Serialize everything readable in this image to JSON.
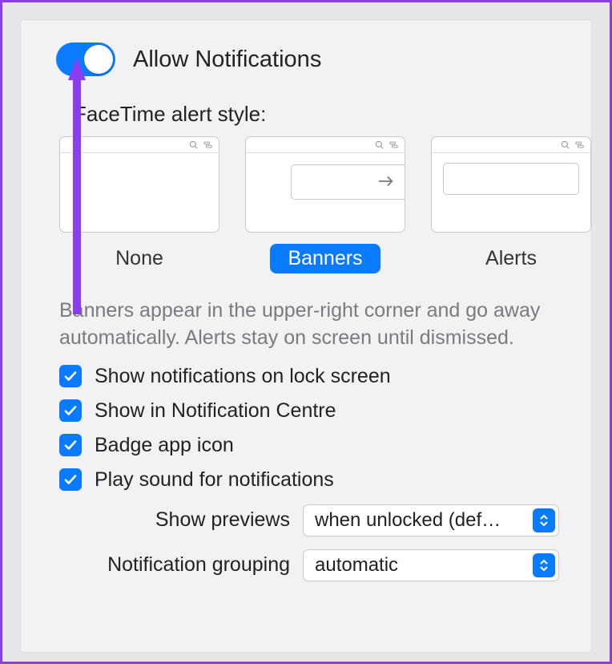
{
  "allow": {
    "label": "Allow Notifications",
    "enabled": true
  },
  "alert_style": {
    "section_label": "FaceTime alert style:",
    "options": {
      "none": "None",
      "banners": "Banners",
      "alerts": "Alerts"
    },
    "selected": "banners",
    "description": "Banners appear in the upper-right corner and go away automatically. Alerts stay on screen until dismissed."
  },
  "checks": {
    "lock_screen": {
      "label": "Show notifications on lock screen",
      "checked": true
    },
    "notif_centre": {
      "label": "Show in Notification Centre",
      "checked": true
    },
    "badge": {
      "label": "Badge app icon",
      "checked": true
    },
    "sound": {
      "label": "Play sound for notifications",
      "checked": true
    }
  },
  "dropdowns": {
    "previews": {
      "label": "Show previews",
      "value": "when unlocked (def…"
    },
    "grouping": {
      "label": "Notification grouping",
      "value": "automatic"
    }
  },
  "colors": {
    "accent": "#0a7bff",
    "annotation": "#8a3cf0"
  }
}
